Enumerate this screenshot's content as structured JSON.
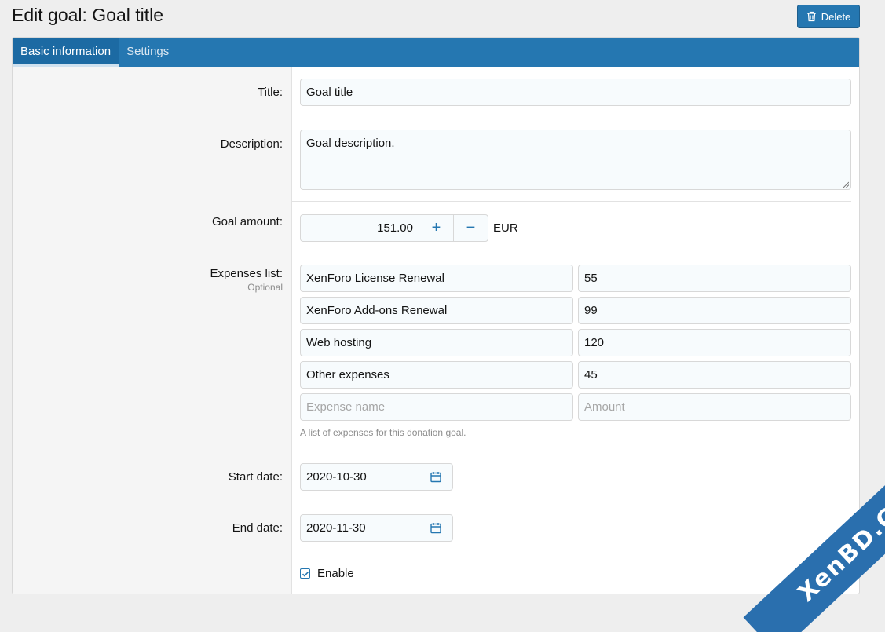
{
  "header": {
    "title": "Edit goal: Goal title",
    "delete_label": "Delete"
  },
  "tabs": [
    {
      "label": "Basic information"
    },
    {
      "label": "Settings"
    }
  ],
  "form": {
    "title": {
      "label": "Title:",
      "value": "Goal title"
    },
    "description": {
      "label": "Description:",
      "value": "Goal description."
    },
    "goal_amount": {
      "label": "Goal amount:",
      "value": "151.00",
      "increase": "+",
      "decrease": "−",
      "currency": "EUR"
    },
    "expenses": {
      "label": "Expenses list:",
      "hint": "Optional",
      "items": [
        {
          "name": "XenForo License Renewal",
          "amount": "55"
        },
        {
          "name": "XenForo Add-ons Renewal",
          "amount": "99"
        },
        {
          "name": "Web hosting",
          "amount": "120"
        },
        {
          "name": "Other expenses",
          "amount": "45"
        }
      ],
      "name_placeholder": "Expense name",
      "amount_placeholder": "Amount",
      "explain": "A list of expenses for this donation goal."
    },
    "start_date": {
      "label": "Start date:",
      "value": "2020-10-30"
    },
    "end_date": {
      "label": "End date:",
      "value": "2020-11-30"
    },
    "enable": {
      "label": "Enable",
      "checked": true
    }
  },
  "watermark": {
    "text": "XenBD.Com"
  },
  "colors": {
    "accent": "#2577b1",
    "label_bg": "#f5f5f5",
    "input_bg": "#f7fbfd"
  },
  "icons": {
    "delete": "trash-icon",
    "date": "calendar-icon",
    "check": "checkmark-icon"
  }
}
